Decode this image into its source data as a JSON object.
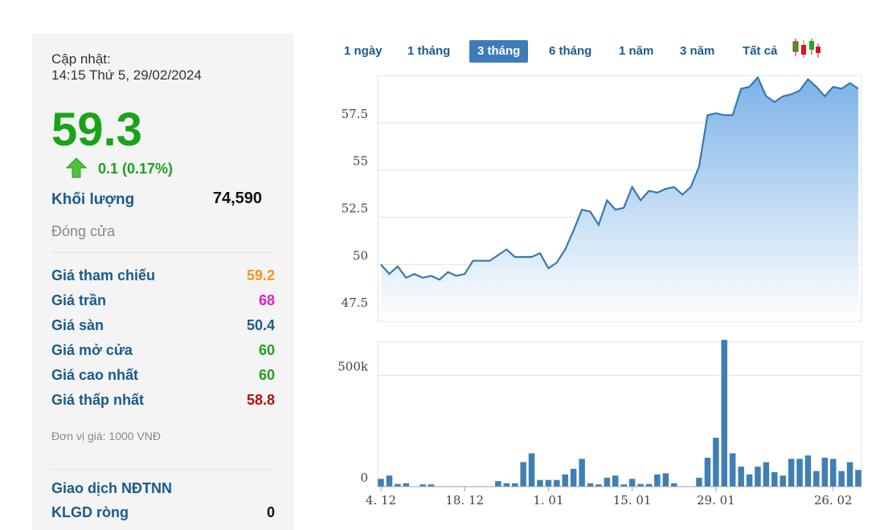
{
  "panel": {
    "update_label": "Cập nhật:",
    "update_time": "14:15 Thứ 5, 29/02/2024",
    "price": "59.3",
    "change": "0.1 (0.17%)",
    "volume_label": "Khối lượng",
    "volume_value": "74,590",
    "status": "Đóng cửa",
    "rows": [
      {
        "label": "Giá tham chiếu",
        "value": "59.2",
        "color": "#f0961e"
      },
      {
        "label": "Giá trần",
        "value": "68",
        "color": "#e21ccf"
      },
      {
        "label": "Giá sàn",
        "value": "50.4",
        "color": "#1b5a8c"
      },
      {
        "label": "Giá mở cửa",
        "value": "60",
        "color": "#1aa31a"
      },
      {
        "label": "Giá cao nhất",
        "value": "60",
        "color": "#1aa31a"
      },
      {
        "label": "Giá thấp nhất",
        "value": "58.8",
        "color": "#b80f0f"
      }
    ],
    "unit_note": "Đơn vị giá: 1000 VNĐ",
    "foreign_label": "Giao dịch NĐTNN",
    "net_label": "KLGD ròng",
    "net_value": "0"
  },
  "tabs": [
    {
      "label": "1 ngày",
      "active": false
    },
    {
      "label": "1 tháng",
      "active": false
    },
    {
      "label": "3 tháng",
      "active": true
    },
    {
      "label": "6 tháng",
      "active": false
    },
    {
      "label": "1 năm",
      "active": false
    },
    {
      "label": "3 năm",
      "active": false
    },
    {
      "label": "Tất cả",
      "active": false
    }
  ],
  "icons": {
    "candlestick": "candlestick-chart-icon",
    "up_arrow": "up-arrow-icon"
  },
  "colors": {
    "line": "#3a78b0",
    "area": "#7fb4e6",
    "bar": "#3f7fb3",
    "up": "#1aa31a"
  },
  "chart_data": [
    {
      "type": "area",
      "y_ticks": [
        "57.5",
        "55",
        "52.5",
        "50",
        "47.5"
      ],
      "ylim": [
        47.0,
        60.0
      ],
      "grid": true,
      "values": [
        50.0,
        49.5,
        49.9,
        49.3,
        49.5,
        49.3,
        49.4,
        49.2,
        49.6,
        49.4,
        49.5,
        50.2,
        50.2,
        50.2,
        50.5,
        50.8,
        50.4,
        50.4,
        50.4,
        50.6,
        49.8,
        50.1,
        50.8,
        51.8,
        52.9,
        52.8,
        52.1,
        53.4,
        52.9,
        53.0,
        54.1,
        53.4,
        53.9,
        53.8,
        54.0,
        54.1,
        53.7,
        54.1,
        55.2,
        57.9,
        58.0,
        57.9,
        57.9,
        59.3,
        59.4,
        59.9,
        58.9,
        58.6,
        58.9,
        59.0,
        59.2,
        59.8,
        59.4,
        58.9,
        59.4,
        59.3,
        59.6,
        59.3
      ]
    },
    {
      "type": "bar",
      "x_ticks": [
        "4. 12",
        "18. 12",
        "1. 01",
        "15. 01",
        "29. 01",
        "26. 02"
      ],
      "y_ticks": [
        "500k",
        "0"
      ],
      "ylim": [
        0,
        650000
      ],
      "grid": true,
      "values": [
        35000,
        50000,
        12000,
        15000,
        0,
        10000,
        10000,
        0,
        0,
        0,
        0,
        0,
        0,
        0,
        25000,
        15000,
        15000,
        110000,
        150000,
        30000,
        30000,
        30000,
        55000,
        80000,
        125000,
        15000,
        10000,
        40000,
        50000,
        10000,
        35000,
        12000,
        12000,
        55000,
        60000,
        15000,
        0,
        0,
        40000,
        130000,
        220000,
        660000,
        150000,
        90000,
        55000,
        90000,
        110000,
        65000,
        50000,
        125000,
        125000,
        140000,
        70000,
        130000,
        125000,
        70000,
        110000,
        75000
      ]
    }
  ]
}
